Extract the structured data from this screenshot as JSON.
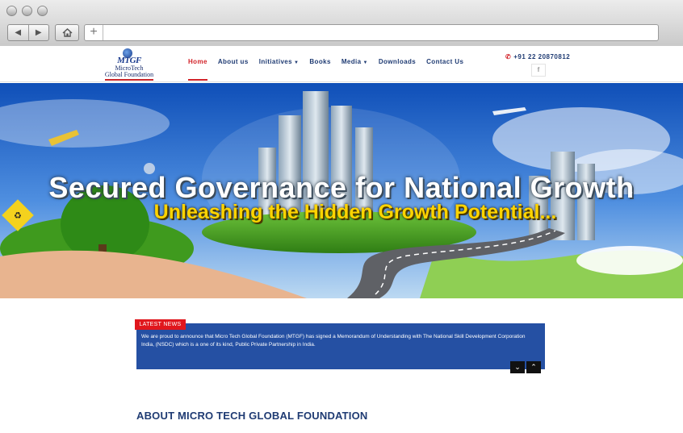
{
  "browser": {
    "window_controls": [
      "close",
      "minimize",
      "zoom"
    ],
    "back_icon": "back-arrow-icon",
    "forward_icon": "forward-arrow-icon",
    "home_icon": "home-icon",
    "new_tab_label": "+",
    "url": ""
  },
  "site": {
    "logo": {
      "mark": "MTGF",
      "line1": "MicroTech",
      "line2": "Global Foundation"
    },
    "nav": [
      {
        "label": "Home",
        "active": true,
        "has_dropdown": false
      },
      {
        "label": "About us",
        "active": false,
        "has_dropdown": false
      },
      {
        "label": "Initiatives",
        "active": false,
        "has_dropdown": true
      },
      {
        "label": "Books",
        "active": false,
        "has_dropdown": false
      },
      {
        "label": "Media",
        "active": false,
        "has_dropdown": true
      },
      {
        "label": "Downloads",
        "active": false,
        "has_dropdown": false
      },
      {
        "label": "Contact Us",
        "active": false,
        "has_dropdown": false
      }
    ],
    "phone": "+91 22 20870812",
    "social_icon": "facebook-icon",
    "social_label": "f"
  },
  "banner": {
    "headline": "Secured Governance for National Growth",
    "subheadline": "Unleashing the Hidden Growth Potential..."
  },
  "news": {
    "tab_label": "LATEST NEWS",
    "text": "We are proud to announce that Micro Tech Global Foundation (MTGF) has signed a Memorandum of Understanding with The National Skill Development Corporation India, (NSDC) which is a one of its kind, Public Private Partnership in India."
  },
  "about": {
    "title": "ABOUT MICRO TECH GLOBAL FOUNDATION"
  },
  "colors": {
    "brand_blue": "#1f3b73",
    "accent_red": "#d22329",
    "news_blue": "#2550a3",
    "banner_yellow": "#ffd400"
  }
}
